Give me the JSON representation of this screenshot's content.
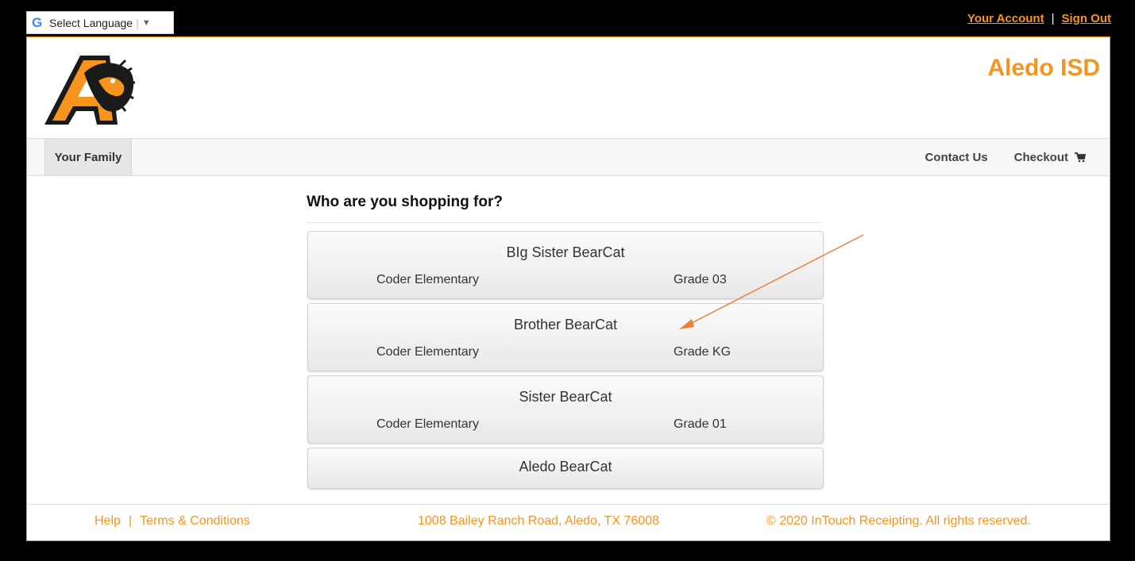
{
  "topbar": {
    "translate_label": "Select Language",
    "your_account": "Your Account",
    "sign_out": "Sign Out"
  },
  "header": {
    "district": "Aledo ISD"
  },
  "nav": {
    "active_tab": "Your Family",
    "contact": "Contact Us",
    "checkout": "Checkout"
  },
  "main": {
    "heading": "Who are you shopping for?",
    "students": [
      {
        "name": "BIg Sister BearCat",
        "school": "Coder Elementary",
        "grade": "Grade 03"
      },
      {
        "name": "Brother BearCat",
        "school": "Coder Elementary",
        "grade": "Grade KG"
      },
      {
        "name": "Sister BearCat",
        "school": "Coder Elementary",
        "grade": "Grade 01"
      },
      {
        "name": "Aledo BearCat"
      }
    ]
  },
  "footer": {
    "help": "Help",
    "terms": "Terms & Conditions",
    "address": "1008 Bailey Ranch Road, Aledo, TX 76008",
    "copyright": "© 2020 InTouch Receipting. All rights reserved."
  },
  "colors": {
    "accent": "#f7941d",
    "annotation_arrow": "#e8823a"
  }
}
